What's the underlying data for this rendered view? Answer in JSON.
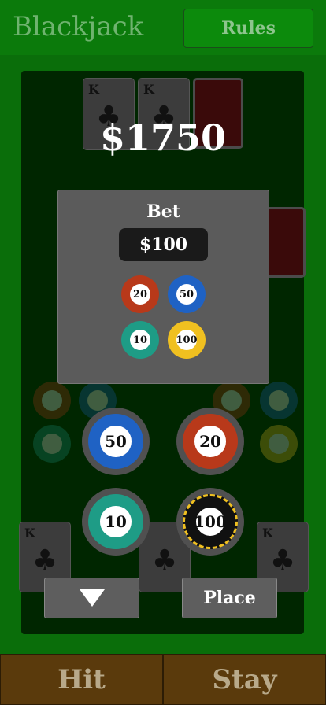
{
  "header": {
    "title": "Blackjack",
    "rules_label": "Rules"
  },
  "dealer": {
    "cards": [
      {
        "rank": "K",
        "suit": "♣"
      },
      {
        "rank": "K",
        "suit": "♣"
      }
    ]
  },
  "player": {
    "cards": [
      {
        "rank": "K",
        "suit": "♣"
      },
      {
        "rank": "K",
        "suit": "♣"
      }
    ]
  },
  "balance": "$1750",
  "bet_panel": {
    "label": "Bet",
    "value": "$100",
    "chips": [
      "20",
      "50",
      "10",
      "100"
    ]
  },
  "chip_selector": {
    "chips": [
      "50",
      "20",
      "10",
      "100"
    ]
  },
  "colors": {
    "chip_20": "#b8391a",
    "chip_50": "#1f62c4",
    "chip_10": "#1e9c86",
    "chip_100": "#111111",
    "chip_100_accent": "#f0c020"
  },
  "controls": {
    "down_icon": "triangle-down-icon",
    "place_label": "Place"
  },
  "footer": {
    "hit_label": "Hit",
    "stay_label": "Stay"
  }
}
